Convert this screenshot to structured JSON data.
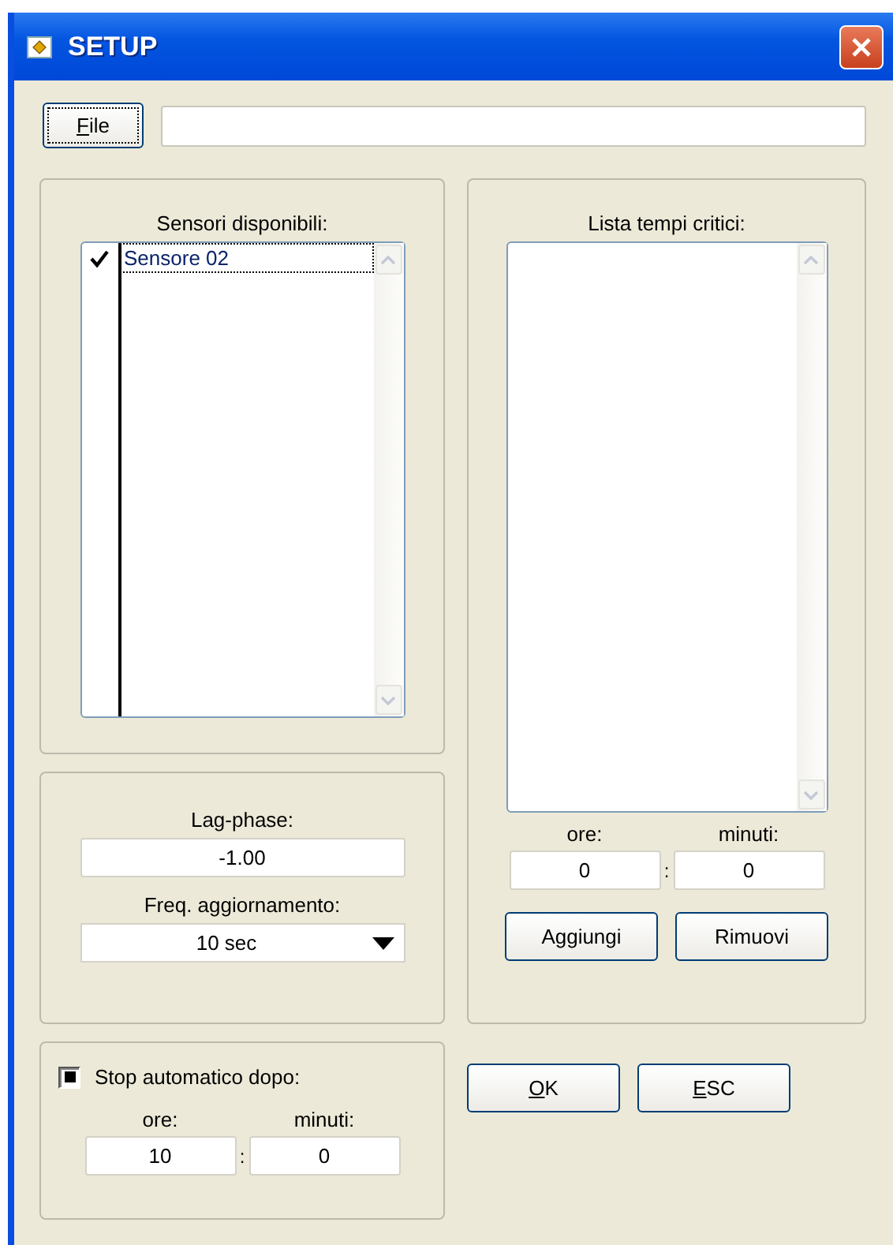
{
  "window": {
    "title": "SETUP"
  },
  "file_button": {
    "label": "File",
    "mnemonic": true
  },
  "sensors": {
    "label": "Sensori disponibili:",
    "items": [
      {
        "name": "Sensore 02",
        "checked": true,
        "selected": true
      }
    ]
  },
  "lag_phase": {
    "label": "Lag-phase:",
    "value": "-1.00"
  },
  "update_freq": {
    "label": "Freq. aggiornamento:",
    "value": "10 sec"
  },
  "auto_stop": {
    "label": "Stop automatico dopo:",
    "checked": true,
    "hours_label": "ore:",
    "minutes_label": "minuti:",
    "hours": "10",
    "separator": ":",
    "minutes": "0"
  },
  "critical_times": {
    "label": "Lista tempi critici:",
    "hours_label": "ore:",
    "minutes_label": "minuti:",
    "hours": "0",
    "separator": ":",
    "minutes": "0"
  },
  "list_buttons": [
    {
      "label": "Aggiungi",
      "mnemonic": false
    },
    {
      "label": "Rimuovi",
      "mnemonic": false
    }
  ],
  "dialog_buttons": [
    {
      "label": "OK",
      "mnemonic": true
    },
    {
      "label": "ESC",
      "mnemonic": true
    }
  ]
}
